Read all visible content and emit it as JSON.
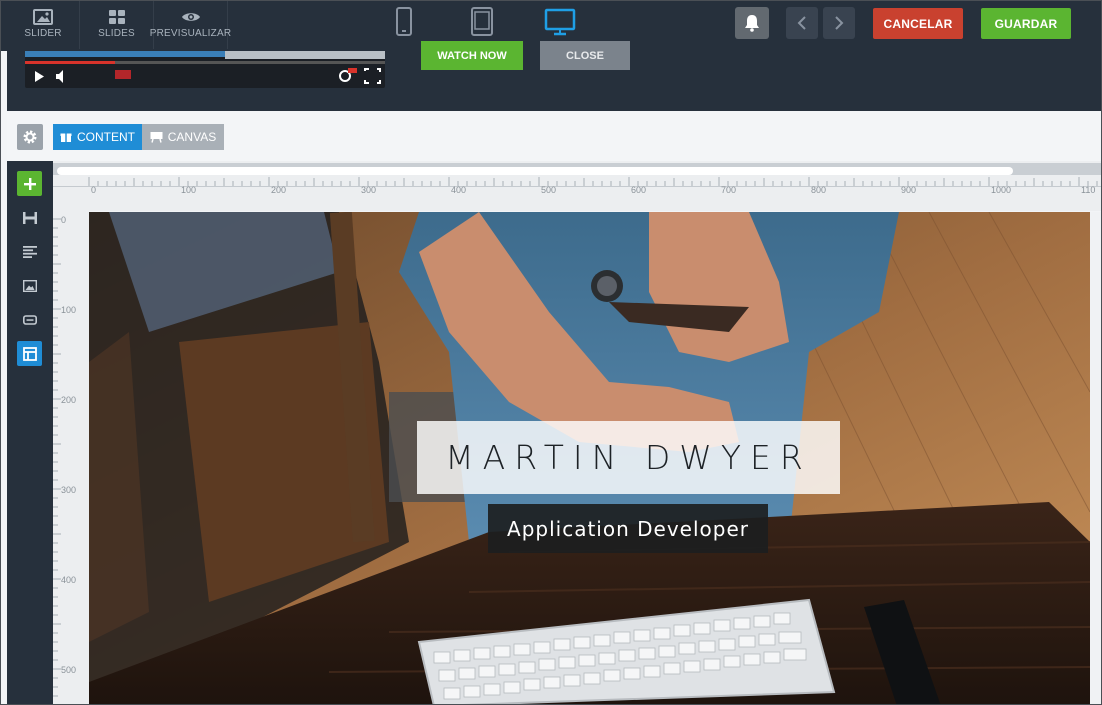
{
  "topbar": {
    "nav": [
      {
        "label": "SLIDER",
        "icon": "image-icon"
      },
      {
        "label": "SLIDES",
        "icon": "grid-icon"
      },
      {
        "label": "PREVISUALIZAR",
        "icon": "eye-icon"
      }
    ],
    "devices": [
      "mobile-icon",
      "tablet-icon",
      "desktop-icon"
    ],
    "active_device": "desktop",
    "cancel_label": "CANCELAR",
    "save_label": "GUARDAR"
  },
  "layers": {
    "watch_label": "WATCH NOW",
    "close_label": "CLOSE"
  },
  "toolbar": {
    "content_label": "CONTENT",
    "canvas_label": "CANVAS"
  },
  "ruler": {
    "top": [
      "0",
      "100",
      "200",
      "300",
      "400",
      "500",
      "600",
      "700",
      "800",
      "900",
      "1000",
      "110"
    ],
    "left": [
      "0",
      "100",
      "200",
      "300",
      "400",
      "500"
    ]
  },
  "slide": {
    "name": "MARTIN DWYER",
    "role": "Application Developer"
  },
  "colors": {
    "dark": "#26303c",
    "accent_blue": "#1f8dd6",
    "green": "#5bb531",
    "red": "#c9412f"
  }
}
